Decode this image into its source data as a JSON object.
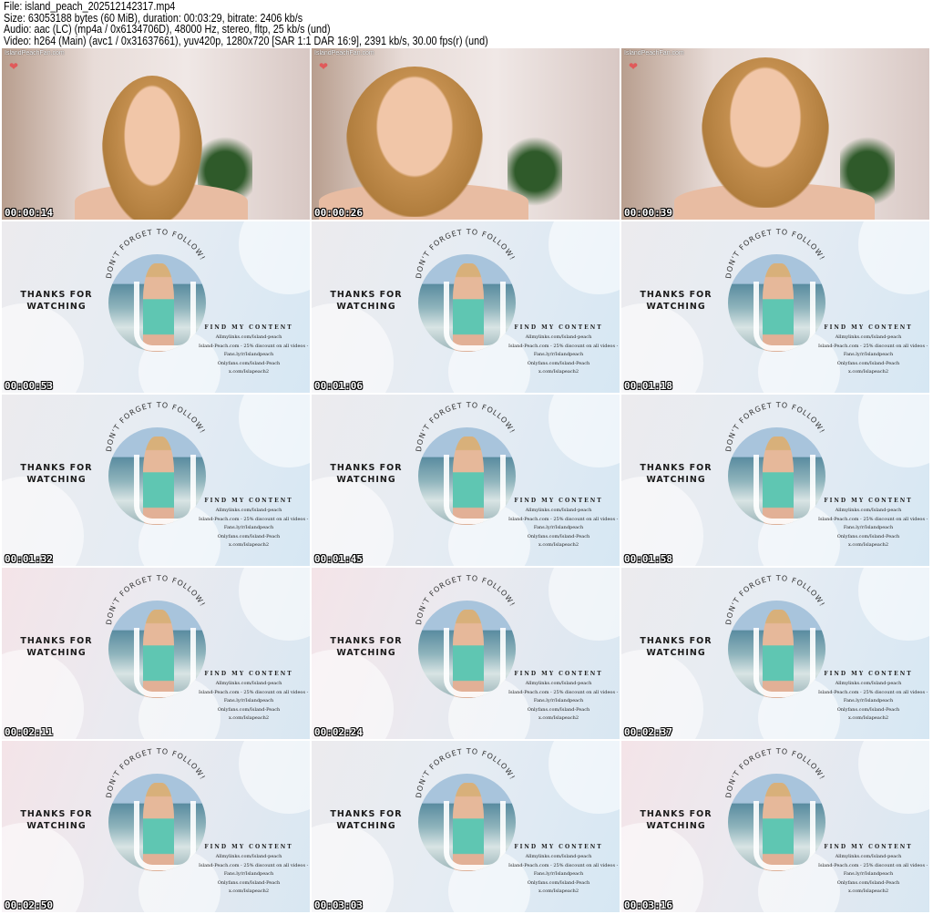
{
  "header": {
    "file": "File: island_peach_202512142317.mp4",
    "size": "Size: 63053188 bytes (60 MiB), duration: 00:03:29, bitrate: 2406 kb/s",
    "audio": "Audio: aac (LC) (mp4a / 0x6134706D), 48000 Hz, stereo, fltp, 25 kb/s (und)",
    "video": "Video: h264 (Main) (avc1 / 0x31637661), yuv420p, 1280x720 [SAR 1:1 DAR 16:9], 2391 kb/s, 30.00 fps(r) (und)"
  },
  "watermark": "IslandPeachFan.com",
  "outro": {
    "thanks": "THANKS FOR WATCHING",
    "follow": "DON'T FORGET TO FOLLOW!",
    "find_heading": "FIND MY CONTENT",
    "links": [
      "Allmylinks.com/Island-peach",
      "Island-Peach.com - 25% discount on all videos -",
      "Fans.ly/r/Islandpeach",
      "Onlyfans.com/Island-Peach",
      "x.com/Islapeach2"
    ]
  },
  "thumbnails": [
    {
      "time": "00:00:14",
      "type": "webcam"
    },
    {
      "time": "00:00:26",
      "type": "webcam"
    },
    {
      "time": "00:00:39",
      "type": "webcam"
    },
    {
      "time": "00:00:53",
      "type": "outro"
    },
    {
      "time": "00:01:06",
      "type": "outro"
    },
    {
      "time": "00:01:18",
      "type": "outro"
    },
    {
      "time": "00:01:32",
      "type": "outro"
    },
    {
      "time": "00:01:45",
      "type": "outro"
    },
    {
      "time": "00:01:58",
      "type": "outro"
    },
    {
      "time": "00:02:11",
      "type": "outro",
      "tint": "pink"
    },
    {
      "time": "00:02:24",
      "type": "outro",
      "tint": "pink"
    },
    {
      "time": "00:02:37",
      "type": "outro"
    },
    {
      "time": "00:02:50",
      "type": "outro",
      "tint": "pink"
    },
    {
      "time": "00:03:03",
      "type": "outro"
    },
    {
      "time": "00:03:16",
      "type": "outro",
      "tint": "pink"
    }
  ]
}
